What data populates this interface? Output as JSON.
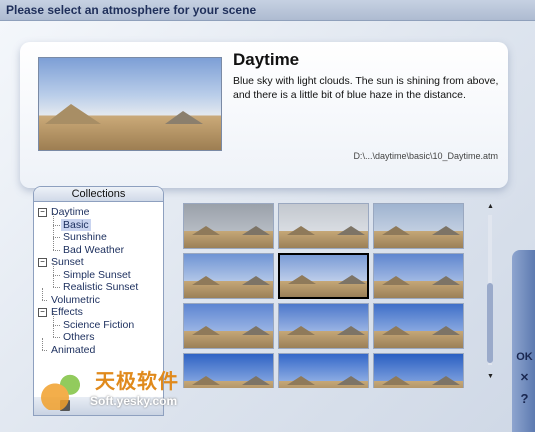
{
  "window": {
    "title": "Please select an atmosphere for your scene"
  },
  "preview": {
    "title": "Daytime",
    "description": "Blue sky with light clouds. The sun is shining from above, and there is a little bit of blue haze in the distance.",
    "path": "D:\\...\\daytime\\basic\\10_Daytime.atm"
  },
  "collections": {
    "header": "Collections",
    "items": [
      {
        "label": "Daytime",
        "level": 0,
        "expander": "−"
      },
      {
        "label": "Basic",
        "level": 1,
        "selected": true
      },
      {
        "label": "Sunshine",
        "level": 1
      },
      {
        "label": "Bad Weather",
        "level": 1
      },
      {
        "label": "Sunset",
        "level": 0,
        "expander": "−"
      },
      {
        "label": "Simple Sunset",
        "level": 1
      },
      {
        "label": "Realistic Sunset",
        "level": 1
      },
      {
        "label": "Volumetric",
        "level": 0
      },
      {
        "label": "Effects",
        "level": 0,
        "expander": "−"
      },
      {
        "label": "Science Fiction",
        "level": 1
      },
      {
        "label": "Others",
        "level": 1
      },
      {
        "label": "Animated",
        "level": 0
      }
    ]
  },
  "thumbnails": [
    {
      "sky": "#9aa1aa",
      "sky2": "#c7ccd3"
    },
    {
      "sky": "#c3c8cf",
      "sky2": "#e6e9ee"
    },
    {
      "sky": "#9fb3d0",
      "sky2": "#d7dfeb"
    },
    {
      "sky": "#6f94d4",
      "sky2": "#dbe5f3"
    },
    {
      "sky": "#7a9bd6",
      "sky2": "#e6ecf5",
      "selected": true
    },
    {
      "sky": "#5f86cf",
      "sky2": "#cad8ef"
    },
    {
      "sky": "#5d85d2",
      "sky2": "#bfd1ef"
    },
    {
      "sky": "#4d78cb",
      "sky2": "#c9d8f2"
    },
    {
      "sky": "#3f6fc8",
      "sky2": "#b6cbef"
    },
    {
      "sky": "#2f63c4",
      "sky2": "#b0c8ef"
    },
    {
      "sky": "#3468c9",
      "sky2": "#c2d5f2"
    },
    {
      "sky": "#2a5fc2",
      "sky2": "#a9c2ec"
    }
  ],
  "side_buttons": {
    "ok": "OK",
    "cancel": "✕",
    "help": "?"
  },
  "watermark": {
    "big": "天极软件",
    "small": "Soft.yesky.com"
  }
}
